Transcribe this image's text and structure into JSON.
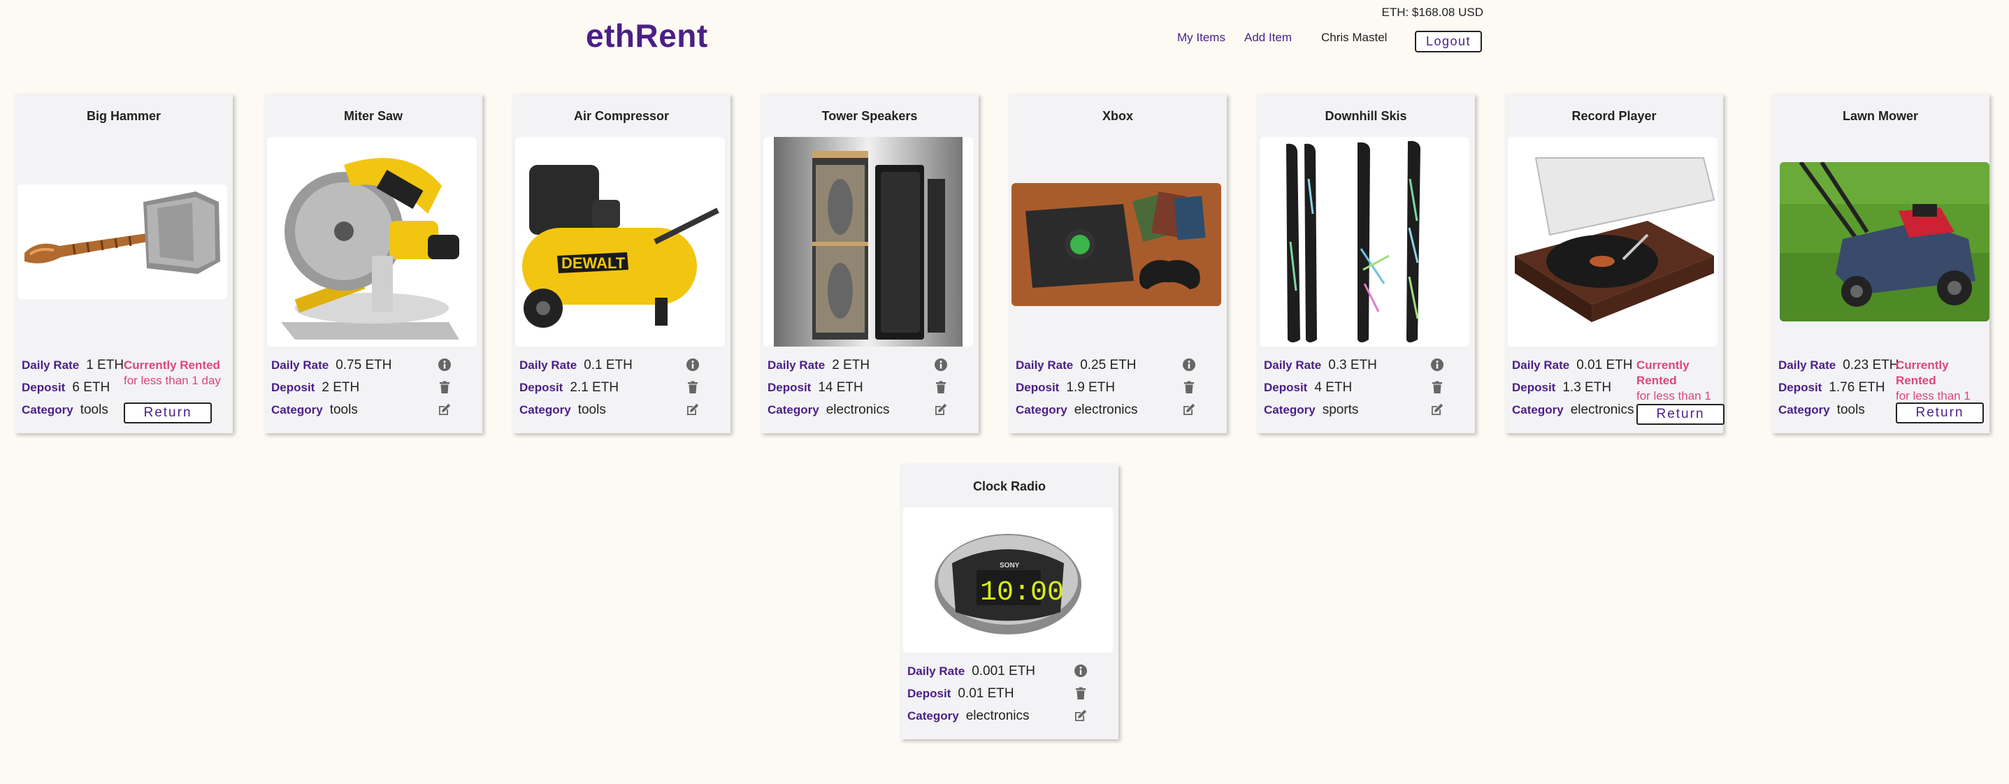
{
  "header": {
    "eth_price": "ETH: $168.08 USD",
    "logo": "ethRent",
    "nav_my_items": "My Items",
    "nav_add_item": "Add Item",
    "user_name": "Chris Mastel",
    "logout_label": "Logout"
  },
  "labels": {
    "daily_rate": "Daily Rate",
    "deposit": "Deposit",
    "category": "Category",
    "rented_line1": "Currently Rented",
    "rented_line2": "for less than 1 day",
    "return": "Return"
  },
  "items": [
    {
      "title": "Big Hammer",
      "daily_rate": "1 ETH",
      "deposit": "6 ETH",
      "category": "tools",
      "rented": true,
      "image": "hammer-image"
    },
    {
      "title": "Miter Saw",
      "daily_rate": "0.75 ETH",
      "deposit": "2 ETH",
      "category": "tools",
      "rented": false,
      "image": "miter-saw-image"
    },
    {
      "title": "Air Compressor",
      "daily_rate": "0.1 ETH",
      "deposit": "2.1 ETH",
      "category": "tools",
      "rented": false,
      "image": "air-compressor-image"
    },
    {
      "title": "Tower Speakers",
      "daily_rate": "2 ETH",
      "deposit": "14 ETH",
      "category": "electronics",
      "rented": false,
      "image": "tower-speakers-image"
    },
    {
      "title": "Xbox",
      "daily_rate": "0.25 ETH",
      "deposit": "1.9 ETH",
      "category": "electronics",
      "rented": false,
      "image": "xbox-image"
    },
    {
      "title": "Downhill Skis",
      "daily_rate": "0.3 ETH",
      "deposit": "4 ETH",
      "category": "sports",
      "rented": false,
      "image": "skis-image"
    },
    {
      "title": "Record Player",
      "daily_rate": "0.01 ETH",
      "deposit": "1.3 ETH",
      "category": "electronics",
      "rented": true,
      "image": "record-player-image"
    },
    {
      "title": "Lawn Mower",
      "daily_rate": "0.23 ETH",
      "deposit": "1.76 ETH",
      "category": "tools",
      "rented": true,
      "image": "lawn-mower-image"
    },
    {
      "title": "Clock Radio",
      "daily_rate": "0.001 ETH",
      "deposit": "0.01 ETH",
      "category": "electronics",
      "rented": false,
      "image": "clock-radio-image"
    }
  ],
  "icons": {
    "info": "info-icon",
    "delete": "trash-icon",
    "edit": "edit-icon"
  },
  "colors": {
    "brand": "#4b1f86",
    "rented": "#e0457b",
    "background": "#fcfaf3",
    "card": "#f3f3f5"
  }
}
